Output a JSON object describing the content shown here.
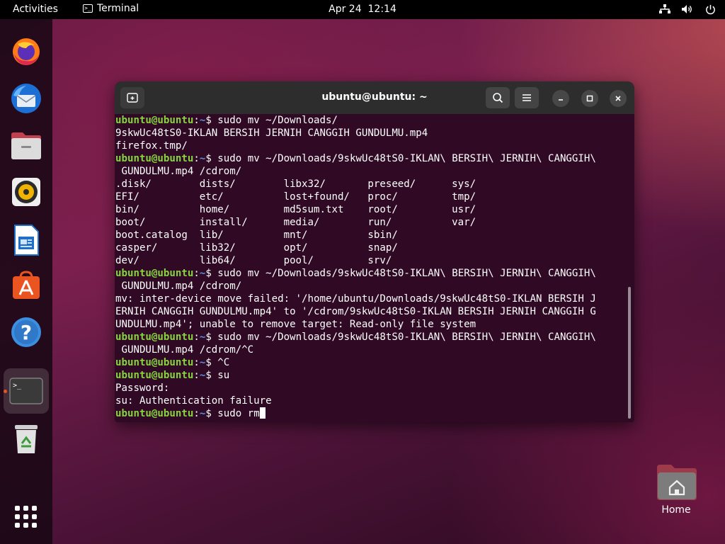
{
  "topbar": {
    "activities": "Activities",
    "app_name": "Terminal",
    "app_icon": "terminal-icon",
    "clock": "Apr 24  12:14",
    "tray_icons": [
      "network-icon",
      "volume-icon",
      "power-icon"
    ]
  },
  "dock": {
    "items": [
      {
        "name": "firefox",
        "icon": "firefox-icon"
      },
      {
        "name": "thunderbird",
        "icon": "thunderbird-icon"
      },
      {
        "name": "files",
        "icon": "files-icon"
      },
      {
        "name": "rhythmbox",
        "icon": "rhythmbox-icon"
      },
      {
        "name": "libreoffice-writer",
        "icon": "writer-icon"
      },
      {
        "name": "ubuntu-software",
        "icon": "software-icon"
      },
      {
        "name": "help",
        "icon": "help-icon"
      },
      {
        "name": "terminal",
        "icon": "terminal-icon",
        "active": true
      },
      {
        "name": "trash",
        "icon": "trash-icon"
      },
      {
        "name": "show-apps",
        "icon": "app-grid-icon"
      }
    ]
  },
  "desktop": {
    "home_label": "Home"
  },
  "window": {
    "title": "ubuntu@ubuntu: ~"
  },
  "terminal": {
    "prompt_user": "ubuntu@ubuntu",
    "prompt_colon": ":",
    "prompt_path": "~",
    "prompt_sign": "$ ",
    "lines": [
      {
        "type": "prompt",
        "text": "sudo mv ~/Downloads/"
      },
      {
        "type": "out",
        "text": "9skwUc48tS0-IKLAN BERSIH JERNIH CANGGIH GUNDULMU.mp4"
      },
      {
        "type": "out",
        "text": "firefox.tmp/"
      },
      {
        "type": "prompt",
        "text": "sudo mv ~/Downloads/9skwUc48tS0-IKLAN\\ BERSIH\\ JERNIH\\ CANGGIH\\"
      },
      {
        "type": "out",
        "text": " GUNDULMU.mp4 /cdrom/"
      },
      {
        "type": "out",
        "text": ".disk/        dists/        libx32/       preseed/      sys/"
      },
      {
        "type": "out",
        "text": "EFI/          etc/          lost+found/   proc/         tmp/"
      },
      {
        "type": "out",
        "text": "bin/          home/         md5sum.txt    root/         usr/"
      },
      {
        "type": "out",
        "text": "boot/         install/      media/        run/          var/"
      },
      {
        "type": "out",
        "text": "boot.catalog  lib/          mnt/          sbin/"
      },
      {
        "type": "out",
        "text": "casper/       lib32/        opt/          snap/"
      },
      {
        "type": "out",
        "text": "dev/          lib64/        pool/         srv/"
      },
      {
        "type": "prompt",
        "text": "sudo mv ~/Downloads/9skwUc48tS0-IKLAN\\ BERSIH\\ JERNIH\\ CANGGIH\\"
      },
      {
        "type": "out",
        "text": " GUNDULMU.mp4 /cdrom/"
      },
      {
        "type": "out",
        "text": "mv: inter-device move failed: '/home/ubuntu/Downloads/9skwUc48tS0-IKLAN BERSIH J"
      },
      {
        "type": "out",
        "text": "ERNIH CANGGIH GUNDULMU.mp4' to '/cdrom/9skwUc48tS0-IKLAN BERSIH JERNIH CANGGIH G"
      },
      {
        "type": "out",
        "text": "UNDULMU.mp4'; unable to remove target: Read-only file system"
      },
      {
        "type": "prompt",
        "text": "sudo mv ~/Downloads/9skwUc48tS0-IKLAN\\ BERSIH\\ JERNIH\\ CANGGIH\\"
      },
      {
        "type": "out",
        "text": " GUNDULMU.mp4 /cdrom/^C"
      },
      {
        "type": "prompt",
        "text": "^C"
      },
      {
        "type": "prompt",
        "text": "su"
      },
      {
        "type": "out",
        "text": "Password: "
      },
      {
        "type": "out",
        "text": "su: Authentication failure"
      },
      {
        "type": "prompt",
        "text": "sudo rm",
        "cursor": true
      }
    ]
  }
}
